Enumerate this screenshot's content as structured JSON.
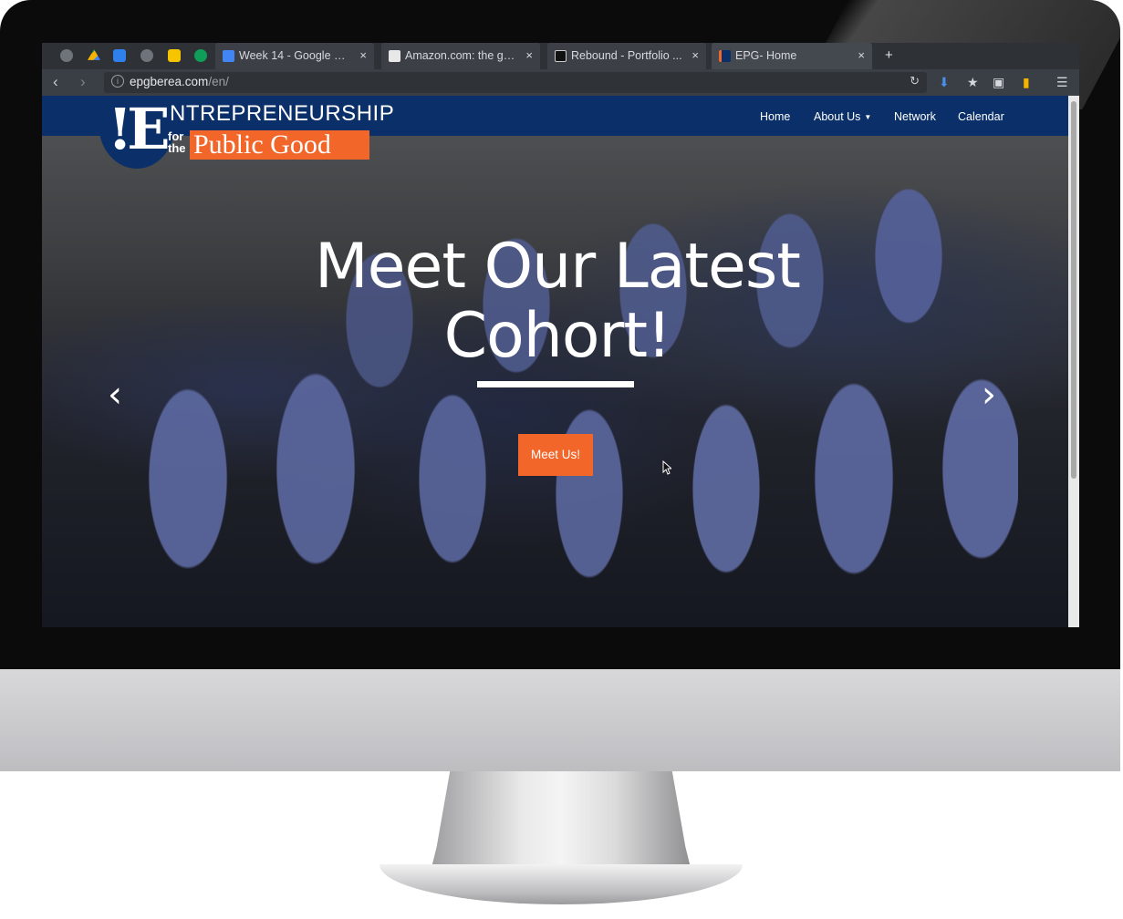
{
  "browser": {
    "pinned_tabs": [
      {
        "icon": "globe-icon",
        "color": "#8a8f96"
      },
      {
        "icon": "google-drive-icon",
        "color": "#f4b400"
      },
      {
        "icon": "mail-icon",
        "color": "#2f80ed"
      },
      {
        "icon": "globe-icon",
        "color": "#8a8f96"
      },
      {
        "icon": "google-keep-icon",
        "color": "#f6c500"
      },
      {
        "icon": "hangouts-icon",
        "color": "#0f9d58"
      }
    ],
    "tabs": [
      {
        "title": "Week 14 - Google Do...",
        "close": "×",
        "favicon_color": "#4285f4"
      },
      {
        "title": "Amazon.com: the go...",
        "close": "×",
        "favicon_color": "#e8e8e8"
      },
      {
        "title": "Rebound - Portfolio ...",
        "close": "×",
        "favicon_color": "#111111"
      },
      {
        "title": "EPG- Home",
        "close": "×",
        "favicon_color": "#0b3069"
      }
    ],
    "new_tab": "+",
    "url_host": "epgberea.com",
    "url_path": "/en/"
  },
  "site": {
    "logo": {
      "mark": "!E",
      "line1": "NTREPRENEURSHIP",
      "for_the": "for the",
      "line2": "Public Good"
    },
    "nav": {
      "home": "Home",
      "about": "About Us",
      "network": "Network",
      "calendar": "Calendar"
    },
    "hero": {
      "headline": "Meet Our Latest Cohort!",
      "button": "Meet Us!",
      "prev": "‹",
      "next": "›"
    }
  },
  "colors": {
    "navbar": "#0b3069",
    "accent": "#f2662a"
  }
}
